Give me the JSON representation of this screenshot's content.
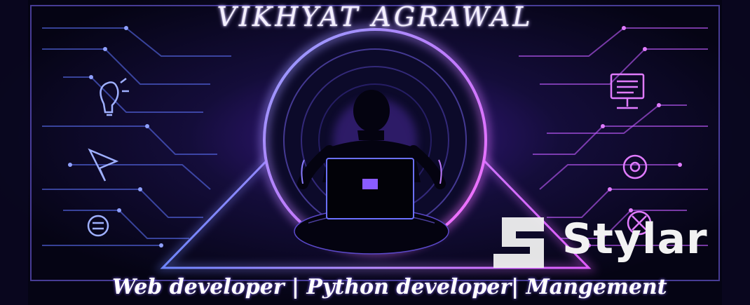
{
  "banner": {
    "title": "VIKHYAT  AGRAWAL",
    "tagline": "Web developer  |  Python developer| Mangement",
    "watermark_text": "Stylar"
  },
  "colors": {
    "background": "#07061a",
    "neon_blue": "#5a7bff",
    "neon_purple": "#b25cff",
    "neon_magenta": "#e14cff",
    "screen_accent": "#8a5cff"
  },
  "icons": {
    "left": [
      "lightbulb-icon",
      "send-arrow-icon",
      "chat-bubble-icon"
    ],
    "right": [
      "monitor-icon",
      "gear-icon",
      "compass-icon"
    ]
  }
}
